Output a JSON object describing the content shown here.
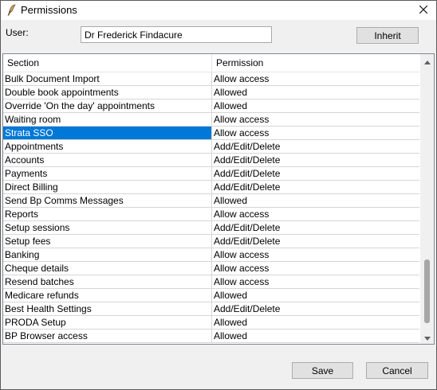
{
  "window": {
    "title": "Permissions",
    "app_icon": "quill-icon",
    "close_icon": "close-icon"
  },
  "user": {
    "label": "User:",
    "value": "Dr Frederick Findacure",
    "inherit_label": "Inherit"
  },
  "table": {
    "columns": [
      "Section",
      "Permission"
    ],
    "selected_index": 4,
    "rows": [
      {
        "section": "Bulk Document Import",
        "permission": "Allow access"
      },
      {
        "section": "Double book appointments",
        "permission": "Allowed"
      },
      {
        "section": "Override 'On the day' appointments",
        "permission": "Allowed"
      },
      {
        "section": "Waiting room",
        "permission": "Allow access"
      },
      {
        "section": "Strata SSO",
        "permission": "Allow access"
      },
      {
        "section": "Appointments",
        "permission": "Add/Edit/Delete"
      },
      {
        "section": "Accounts",
        "permission": "Add/Edit/Delete"
      },
      {
        "section": "Payments",
        "permission": "Add/Edit/Delete"
      },
      {
        "section": "Direct Billing",
        "permission": "Add/Edit/Delete"
      },
      {
        "section": "Send Bp Comms Messages",
        "permission": "Allowed"
      },
      {
        "section": "Reports",
        "permission": "Allow access"
      },
      {
        "section": "Setup sessions",
        "permission": "Add/Edit/Delete"
      },
      {
        "section": "Setup fees",
        "permission": "Add/Edit/Delete"
      },
      {
        "section": "Banking",
        "permission": "Allow access"
      },
      {
        "section": "Cheque details",
        "permission": "Allow access"
      },
      {
        "section": "Resend batches",
        "permission": "Allow access"
      },
      {
        "section": "Medicare refunds",
        "permission": "Allowed"
      },
      {
        "section": "Best Health Settings",
        "permission": "Add/Edit/Delete"
      },
      {
        "section": "PRODA Setup",
        "permission": "Allowed"
      },
      {
        "section": "BP Browser access",
        "permission": "Allowed"
      }
    ]
  },
  "footer": {
    "save_label": "Save",
    "cancel_label": "Cancel"
  },
  "colors": {
    "selection": "#0078d7",
    "dialog_bg": "#f0f0f0"
  }
}
